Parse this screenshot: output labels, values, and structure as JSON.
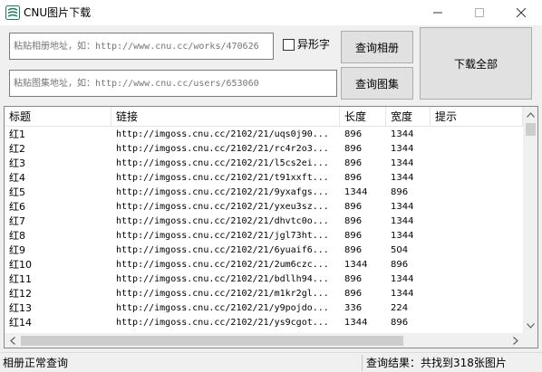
{
  "window": {
    "title": "CNU图片下载"
  },
  "inputs": {
    "album_placeholder": "粘贴相册地址，如：http://www.cnu.cc/works/470626",
    "set_placeholder": "粘贴图集地址，如：http://www.cnu.cc/users/653060"
  },
  "checkbox": {
    "label": "异形字",
    "checked": false
  },
  "buttons": {
    "query_album": "查询相册",
    "query_set": "查询图集",
    "download_all": "下载全部"
  },
  "table": {
    "headers": [
      "标题",
      "链接",
      "长度",
      "宽度",
      "提示"
    ],
    "rows": [
      {
        "title": "红1",
        "link": "http://imgoss.cnu.cc/2102/21/uqs0j90...",
        "length": "896",
        "width": "1344",
        "hint": ""
      },
      {
        "title": "红2",
        "link": "http://imgoss.cnu.cc/2102/21/rc4r2o3...",
        "length": "896",
        "width": "1344",
        "hint": ""
      },
      {
        "title": "红3",
        "link": "http://imgoss.cnu.cc/2102/21/l5cs2ei...",
        "length": "896",
        "width": "1344",
        "hint": ""
      },
      {
        "title": "红4",
        "link": "http://imgoss.cnu.cc/2102/21/t91xxft...",
        "length": "896",
        "width": "1344",
        "hint": ""
      },
      {
        "title": "红5",
        "link": "http://imgoss.cnu.cc/2102/21/9yxafgs...",
        "length": "1344",
        "width": "896",
        "hint": ""
      },
      {
        "title": "红6",
        "link": "http://imgoss.cnu.cc/2102/21/yxeu3sz...",
        "length": "896",
        "width": "1344",
        "hint": ""
      },
      {
        "title": "红7",
        "link": "http://imgoss.cnu.cc/2102/21/dhvtc0o...",
        "length": "896",
        "width": "1344",
        "hint": ""
      },
      {
        "title": "红8",
        "link": "http://imgoss.cnu.cc/2102/21/jgl73ht...",
        "length": "896",
        "width": "1344",
        "hint": ""
      },
      {
        "title": "红9",
        "link": "http://imgoss.cnu.cc/2102/21/6yuaif6...",
        "length": "896",
        "width": "504",
        "hint": ""
      },
      {
        "title": "红10",
        "link": "http://imgoss.cnu.cc/2102/21/2um6czc...",
        "length": "1344",
        "width": "896",
        "hint": ""
      },
      {
        "title": "红11",
        "link": "http://imgoss.cnu.cc/2102/21/bdllh94...",
        "length": "896",
        "width": "1344",
        "hint": ""
      },
      {
        "title": "红12",
        "link": "http://imgoss.cnu.cc/2102/21/m1kr2gl...",
        "length": "896",
        "width": "1344",
        "hint": ""
      },
      {
        "title": "红13",
        "link": "http://imgoss.cnu.cc/2102/21/y9pojdo...",
        "length": "336",
        "width": "224",
        "hint": ""
      },
      {
        "title": "红14",
        "link": "http://imgoss.cnu.cc/2102/21/ys9cgot...",
        "length": "1344",
        "width": "896",
        "hint": ""
      }
    ]
  },
  "status": {
    "left": "相册正常查询",
    "right": "查询结果：共找到318张图片"
  }
}
